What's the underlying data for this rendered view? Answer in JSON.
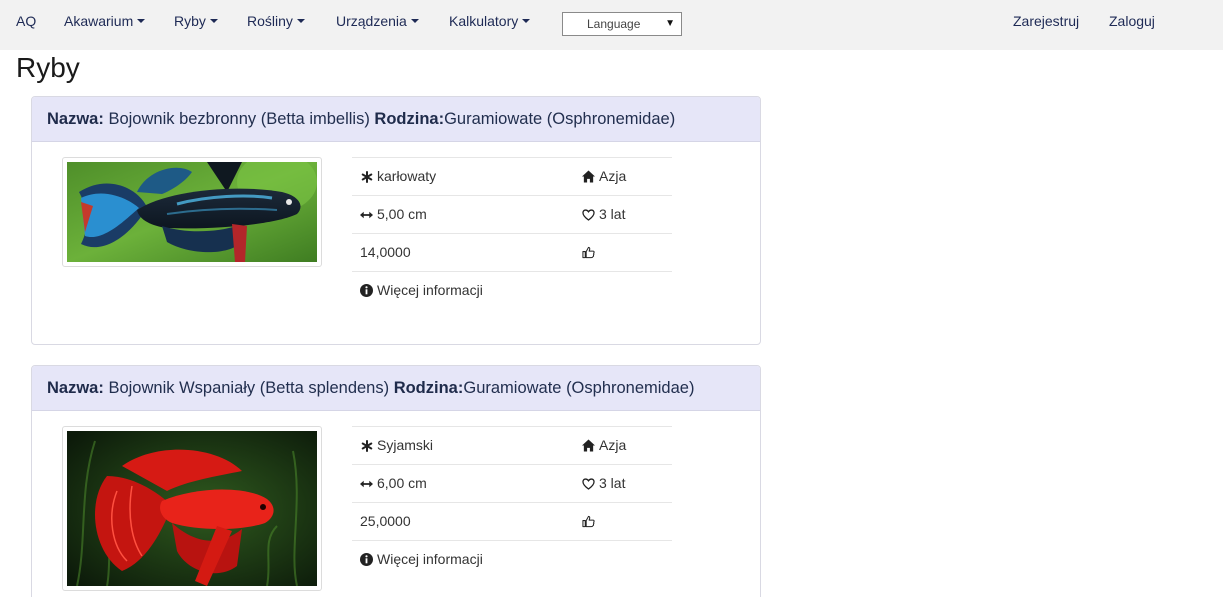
{
  "nav": {
    "brand": "AQ",
    "menu": [
      "Akawarium",
      "Ryby",
      "Rośliny",
      "Urządzenia",
      "Kalkulatory"
    ],
    "language_placeholder": "Language",
    "register": "Zarejestruj",
    "login": "Zaloguj"
  },
  "page": {
    "title": "Ryby"
  },
  "labels": {
    "name": "Nazwa:",
    "family": "Rodzina:",
    "more_info": "Więcej informacji"
  },
  "fish": [
    {
      "name": "Bojownik bezbronny (Betta imbellis)",
      "family": "Guramiowate (Osphronemidae)",
      "type": "karłowaty",
      "region": "Azja",
      "size": "5,00 cm",
      "lifespan": "3 lat",
      "value": "14,0000"
    },
    {
      "name": "Bojownik Wspaniały (Betta splendens)",
      "family": "Guramiowate (Osphronemidae)",
      "type": "Syjamski",
      "region": "Azja",
      "size": "6,00 cm",
      "lifespan": "3 lat",
      "value": "25,0000"
    }
  ],
  "colors": {
    "nav_bg": "#f2f2f2",
    "card_header_bg": "#e6e6f8",
    "nav_text": "#1e2a55"
  }
}
